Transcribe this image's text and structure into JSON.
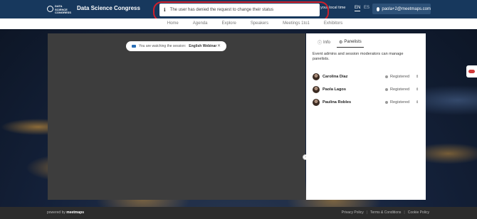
{
  "header": {
    "logo_text": [
      "DATA",
      "SCIENCE",
      "CONGRESS"
    ],
    "app_title": "Data Science Congress",
    "local_time": "your local time",
    "languages": [
      "EN",
      "ES"
    ],
    "active_language": "EN",
    "user_email": "paola+2@meetmaps.com",
    "background": "#17385d"
  },
  "alert": {
    "message": "The user has denied the request to change their status",
    "highlight_color": "#d0202b"
  },
  "nav": {
    "items": [
      "Home",
      "Agenda",
      "Explore",
      "Speakers",
      "Meetings 1to1",
      "Exhibitors"
    ]
  },
  "session": {
    "prefix": "You are watching the session:",
    "name": "English Webinar",
    "close_label": "✕"
  },
  "panel": {
    "tabs": [
      {
        "label": "Info",
        "icon": "info-circle-icon"
      },
      {
        "label": "Panelists",
        "icon": "cogs-icon",
        "active": true
      }
    ],
    "description": "Event admins and session moderators can manage panelists.",
    "panelists": [
      {
        "name": "Carolina Diaz",
        "status": "Registered"
      },
      {
        "name": "Paola Lagos",
        "status": "Registered"
      },
      {
        "name": "Paulina Robles",
        "status": "Registered"
      }
    ]
  },
  "collapse_label": "›",
  "footer": {
    "powered_by": "powered by",
    "brand": "meetmaps",
    "links": [
      "Privacy Policy",
      "Terms & Conditions",
      "Cookie Policy"
    ]
  }
}
